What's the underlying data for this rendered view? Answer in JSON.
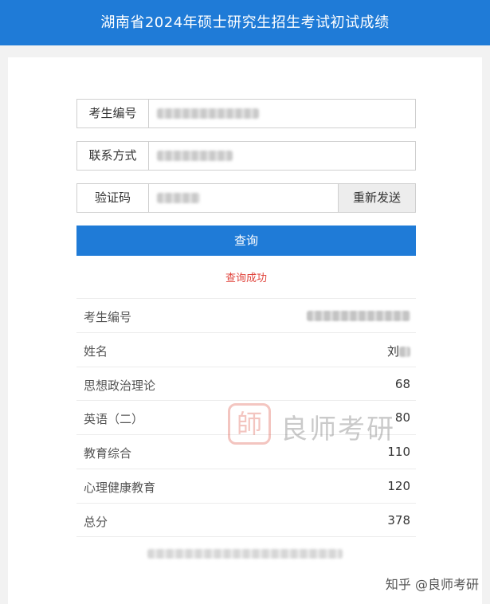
{
  "header": {
    "title": "湖南省2024年硕士研究生招生考试初试成绩"
  },
  "form": {
    "exam_id": {
      "label": "考生编号",
      "value": "10533xxxxxxxxxx"
    },
    "contact": {
      "label": "联系方式",
      "value": "1xxxxxxxxxx"
    },
    "captcha": {
      "label": "验证码",
      "value": "xxxxxx",
      "resend_label": "重新发送"
    },
    "query_label": "查询",
    "status": "查询成功"
  },
  "results": [
    {
      "label": "考生编号",
      "value": "10533xxxxxxxxxx"
    },
    {
      "label": "姓名",
      "value": "刘",
      "value_hidden": "x"
    },
    {
      "label": "思想政治理论",
      "value": "68"
    },
    {
      "label": "英语（二）",
      "value": "80"
    },
    {
      "label": "教育综合",
      "value": "110"
    },
    {
      "label": "心理健康教育",
      "value": "120"
    },
    {
      "label": "总分",
      "value": "378"
    }
  ],
  "footer": {
    "note": "xxxxxxxxxxxxxxxxxxxxxxxx"
  },
  "watermark": {
    "logo_char": "師",
    "text": "良师考研"
  },
  "credit": "知乎 @良师考研",
  "colors": {
    "accent": "#1f7bd7",
    "status": "#e0443c"
  }
}
